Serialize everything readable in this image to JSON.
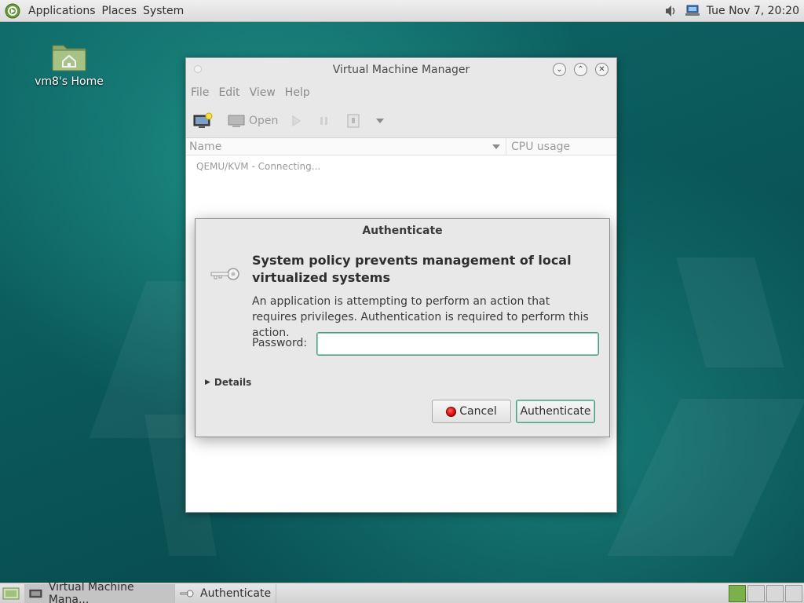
{
  "top_panel": {
    "menus": [
      "Applications",
      "Places",
      "System"
    ],
    "clock": "Tue Nov 7, 20:20",
    "icons": [
      "distro-logo-icon",
      "volume-icon",
      "network-icon"
    ]
  },
  "desktop": {
    "home_icon_label": "vm8's Home"
  },
  "vmm_window": {
    "title": "Virtual Machine Manager",
    "menus": [
      "File",
      "Edit",
      "View",
      "Help"
    ],
    "toolbar": {
      "open_label": "Open"
    },
    "columns": {
      "name": "Name",
      "cpu": "CPU usage"
    },
    "connection_status": "QEMU/KVM - Connecting..."
  },
  "auth_dialog": {
    "title": "Authenticate",
    "headline": "System policy prevents management of local virtualized systems",
    "description": "An application is attempting to perform an action that requires privileges. Authentication is required to perform this action.",
    "password_label": "Password:",
    "password_value": "",
    "details_label": "Details",
    "cancel_label": "Cancel",
    "authenticate_label": "Authenticate"
  },
  "bottom_panel": {
    "tasks": [
      {
        "label": "Virtual Machine Mana...",
        "active": true
      },
      {
        "label": "Authenticate",
        "active": false
      }
    ]
  },
  "colors": {
    "accent": "#4a9a86",
    "desktop_bg": "#0b5a5c",
    "panel_bg": "#e6e6e6"
  }
}
